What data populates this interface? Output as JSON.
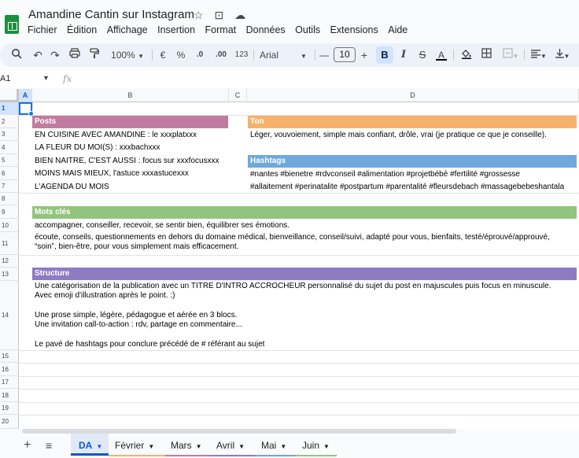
{
  "document": {
    "title": "Amandine Cantin sur Instagram",
    "title_icons": [
      "☆",
      "⊡",
      "☁"
    ]
  },
  "menu": [
    "Fichier",
    "Édition",
    "Affichage",
    "Insertion",
    "Format",
    "Données",
    "Outils",
    "Extensions",
    "Aide"
  ],
  "toolbar": {
    "zoom": "100%",
    "currency": "€",
    "percent": "%",
    "decrease_decimal": ".0",
    "increase_decimal": ".00",
    "number_format": "123",
    "font": "Arial",
    "minus": "—",
    "font_size": "10",
    "plus": "+",
    "bold": "B",
    "italic": "I",
    "strikethrough": "S",
    "text_color": "A"
  },
  "formula_bar": {
    "cell_ref": "A1",
    "fx": "fx"
  },
  "columns": [
    "A",
    "B",
    "C",
    "D"
  ],
  "rows": [
    "1",
    "2",
    "3",
    "4",
    "5",
    "6",
    "7",
    "8",
    "9",
    "10",
    "11",
    "12",
    "13",
    "14",
    "15",
    "16",
    "17",
    "18",
    "19",
    "20"
  ],
  "colors": {
    "posts": "#c27ba0",
    "ton": "#f6b26b",
    "hashtags": "#6fa8dc",
    "mots_cles": "#93c47d",
    "structure": "#8e7cc3"
  },
  "sections": {
    "posts": {
      "title": "Posts",
      "lines": [
        "EN CUISINE AVEC AMANDINE : le xxxplatxxx",
        "LA FLEUR DU MOI(S) : xxxbachxxx",
        "BIEN NAITRE, C'EST AUSSI : focus sur xxxfocusxxx",
        "MOINS MAIS MIEUX, l'astuce xxxastucexxx",
        "L'AGENDA DU MOIS"
      ]
    },
    "ton": {
      "title": "Ton",
      "text": "Léger, vouvoiement, simple mais confiant, drôle, vrai (je pratique ce que je conseille)."
    },
    "hashtags": {
      "title": "Hashtags",
      "line1": "#nantes #bienetre #rdvconseil #alimentation #projetbébé #fertilité #grossesse",
      "line2": "#allaitement #perinatalite #postpartum #parentalité #fleursdebach #massagebebeshantala"
    },
    "mots_cles": {
      "title": "Mots clés",
      "line1": "accompagner, conseiller, recevoir, se sentir bien, équilibrer ses émotions.",
      "line2": " écoute, conseils, questionnements en dehors du domaine médical, bienveillance, conseil/suivi, adapté pour vous, bienfaits, testé/éprouvé/approuvé,",
      "line3": "“soin”, bien-être, pour vous simplement mais efficacement."
    },
    "structure": {
      "title": "Structure",
      "lines": [
        "Une catégorisation de la publication avec un TITRE D'INTRO ACCROCHEUR personnalisé du sujet du post en majuscules puis focus en minuscule.",
        "Avec emoji d'illustration après le point. :)",
        "",
        "Une prose simple, légère, pédagogue et aérée en 3 blocs.",
        "Une invitation call-to-action : rdv, partage en commentaire...",
        "",
        "Le pavé de hashtags pour conclure précédé de # référant au sujet"
      ]
    }
  },
  "sheets": [
    {
      "name": "DA",
      "active": true,
      "color": "#0b57d0"
    },
    {
      "name": "Février",
      "active": false,
      "color": "#f6b26b"
    },
    {
      "name": "Mars",
      "active": false,
      "color": "#c27ba0"
    },
    {
      "name": "Avril",
      "active": false,
      "color": "#8e7cc3"
    },
    {
      "name": "Mai",
      "active": false,
      "color": "#6fa8dc"
    },
    {
      "name": "Juin",
      "active": false,
      "color": "#93c47d"
    }
  ]
}
